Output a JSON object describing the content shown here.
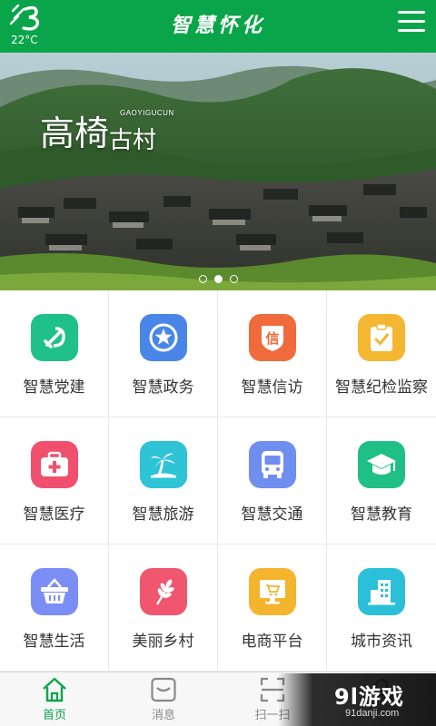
{
  "header": {
    "title": "智慧怀化",
    "temperature": "22°C",
    "weather_icon": "weather-icon",
    "menu_icon": "hamburger-menu-icon"
  },
  "banner": {
    "title_main": "高椅",
    "title_sub": "古村",
    "pinyin": "GAOYIGUCUN",
    "slide_count": 3,
    "active_slide": 1
  },
  "grid": [
    {
      "label": "智慧党建",
      "icon": "party-emblem-icon",
      "color": "#1fc08a"
    },
    {
      "label": "智慧政务",
      "icon": "star-badge-icon",
      "color": "#4a86e8"
    },
    {
      "label": "智慧信访",
      "icon": "petition-shield-icon",
      "color": "#f06a3c"
    },
    {
      "label": "智慧纪检监察",
      "icon": "clipboard-check-icon",
      "color": "#f5b731"
    },
    {
      "label": "智慧医疗",
      "icon": "medical-kit-icon",
      "color": "#f0506e"
    },
    {
      "label": "智慧旅游",
      "icon": "palm-island-icon",
      "color": "#2ec4d6"
    },
    {
      "label": "智慧交通",
      "icon": "bus-icon",
      "color": "#6f8ef0"
    },
    {
      "label": "智慧教育",
      "icon": "graduation-cap-icon",
      "color": "#1fbf86"
    },
    {
      "label": "智慧生活",
      "icon": "shopping-basket-icon",
      "color": "#7b8ef5"
    },
    {
      "label": "美丽乡村",
      "icon": "wheat-icon",
      "color": "#f0566e"
    },
    {
      "label": "电商平台",
      "icon": "computer-cart-icon",
      "color": "#f5b42e"
    },
    {
      "label": "城市资讯",
      "icon": "city-buildings-icon",
      "color": "#2cbfd9"
    }
  ],
  "bottom_nav": [
    {
      "label": "首页",
      "icon": "home-icon",
      "active": true
    },
    {
      "label": "消息",
      "icon": "message-icon",
      "active": false
    },
    {
      "label": "扫一扫",
      "icon": "scan-icon",
      "active": false
    },
    {
      "label": "",
      "icon": "profile-icon",
      "active": false
    }
  ],
  "watermark": {
    "logo": "9l游戏",
    "url": "91danji.com"
  },
  "colors": {
    "brand_green": "#0aa54a",
    "nav_inactive": "#888888"
  }
}
